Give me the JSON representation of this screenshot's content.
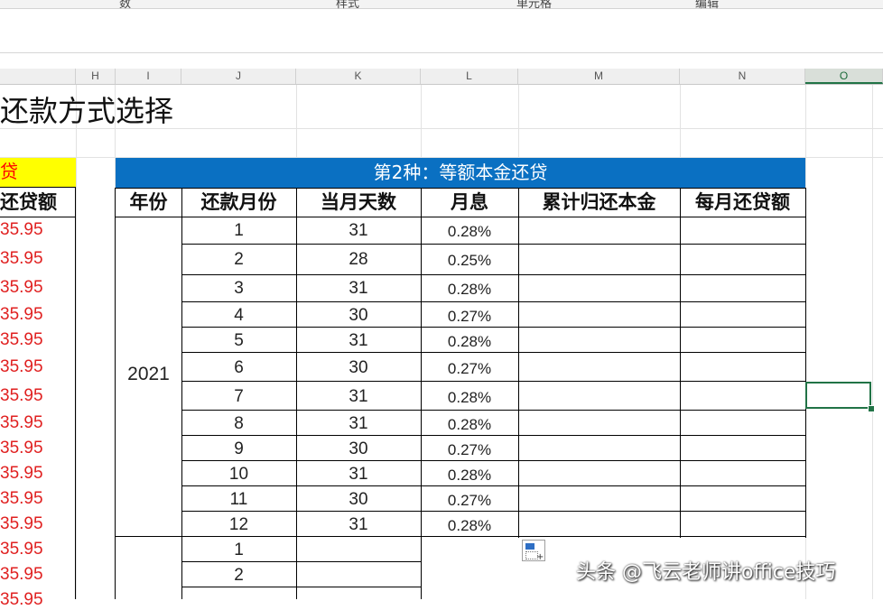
{
  "ribbon": {
    "frag1": "数",
    "frag2": "样式",
    "frag3": "单元格",
    "frag4": "编辑"
  },
  "columns": [
    "H",
    "I",
    "J",
    "K",
    "L",
    "M",
    "N",
    "O"
  ],
  "sheet_title": "还款方式选择",
  "left_panel": {
    "label": "贷",
    "header": "还贷额",
    "values": [
      "35.95",
      "35.95",
      "35.95",
      "35.95",
      "35.95",
      "35.95",
      "35.95",
      "35.95",
      "35.95",
      "35.95",
      "35.95",
      "35.95",
      "35.95",
      "35.95",
      "35.95"
    ]
  },
  "table": {
    "title": "第2种：等额本金还贷",
    "headers": [
      "年份",
      "还款月份",
      "当月天数",
      "月息",
      "累计归还本金",
      "每月还贷额"
    ],
    "year": "2021",
    "rows": [
      {
        "month": "1",
        "days": "31",
        "rate": "0.28%"
      },
      {
        "month": "2",
        "days": "28",
        "rate": "0.25%"
      },
      {
        "month": "3",
        "days": "31",
        "rate": "0.28%"
      },
      {
        "month": "4",
        "days": "30",
        "rate": "0.27%"
      },
      {
        "month": "5",
        "days": "31",
        "rate": "0.28%"
      },
      {
        "month": "6",
        "days": "30",
        "rate": "0.27%"
      },
      {
        "month": "7",
        "days": "31",
        "rate": "0.28%"
      },
      {
        "month": "8",
        "days": "31",
        "rate": "0.28%"
      },
      {
        "month": "9",
        "days": "30",
        "rate": "0.27%"
      },
      {
        "month": "10",
        "days": "31",
        "rate": "0.28%"
      },
      {
        "month": "11",
        "days": "30",
        "rate": "0.27%"
      },
      {
        "month": "12",
        "days": "31",
        "rate": "0.28%"
      }
    ],
    "next_year_months": [
      "1",
      "2"
    ]
  },
  "watermark": "头条 @飞云老师讲office技巧",
  "colors": {
    "banner": "#0a70c2",
    "accent_red": "#e02020",
    "highlight_yellow": "#ffff00",
    "selection": "#217346"
  }
}
